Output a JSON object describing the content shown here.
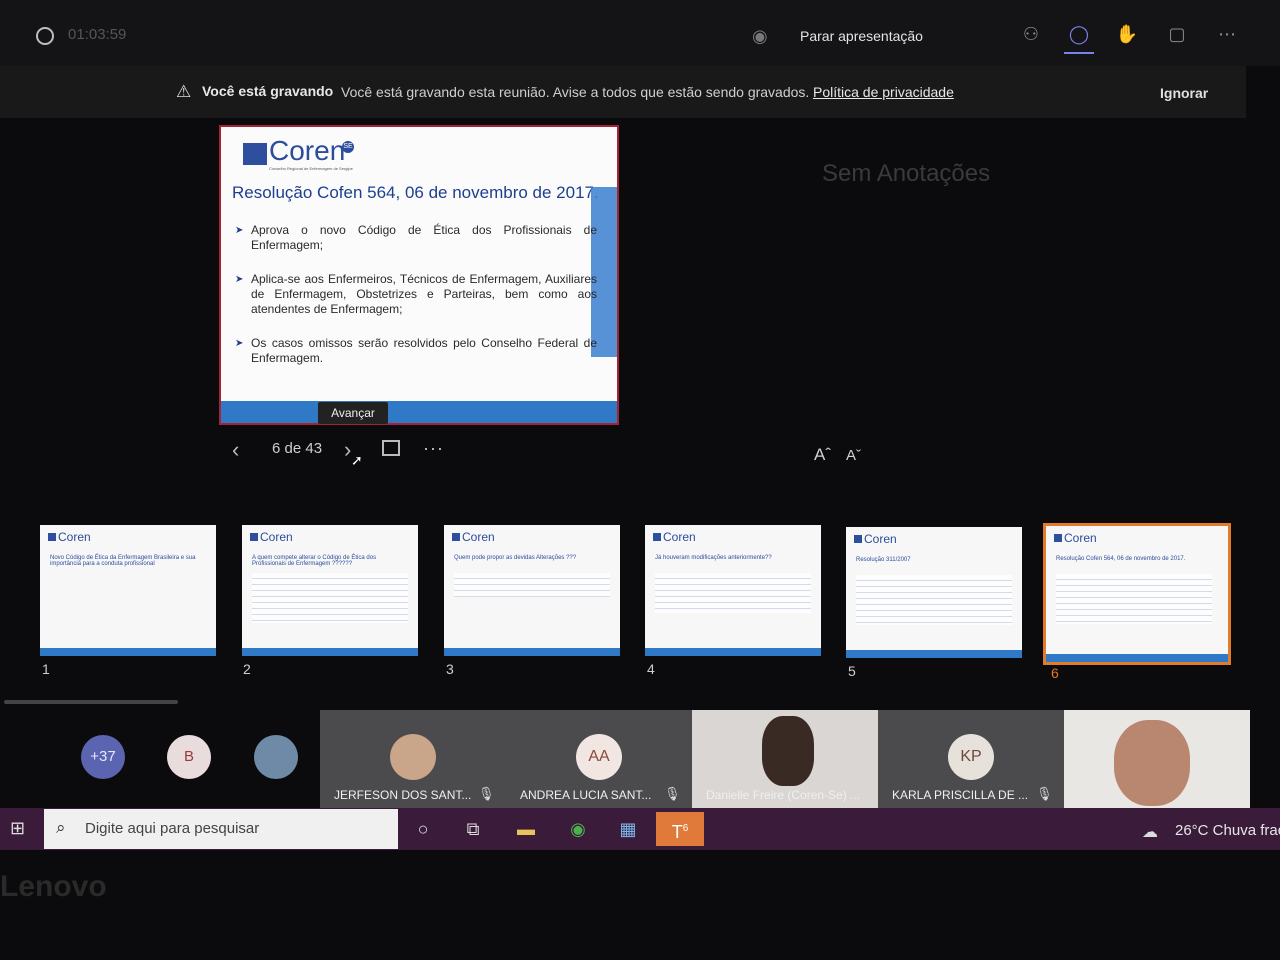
{
  "top_toolbar": {
    "timer": "01:03:59",
    "stop_presenting": "Parar apresentação"
  },
  "banner": {
    "bold": "Você está gravando",
    "text": "Você está gravando esta reunião. Avise a todos que estão sendo gravados.",
    "link": "Política de privacidade",
    "ignore": "Ignorar"
  },
  "slide": {
    "logo": "Coren",
    "logo_badge": "SE",
    "logo_subtitle": "Conselho Regional de Enfermagem de Sergipe",
    "title": "Resolução Cofen 564, 06 de novembro de 2017.",
    "bullets": [
      "Aprova o novo Código de Ética dos Profissionais de Enfermagem;",
      "Aplica-se aos Enfermeiros, Técnicos de Enfermagem, Auxiliares de Enfermagem, Obstetrizes e Parteiras, bem como aos atendentes de Enfermagem;",
      "Os casos omissos serão resolvidos pelo Conselho Federal de Enfermagem."
    ],
    "advance_tooltip": "Avançar"
  },
  "slide_nav": {
    "page_counter": "6 de 43",
    "prev_icon": "chevron-left-icon",
    "next_icon": "chevron-right-icon",
    "more": "···"
  },
  "notes": {
    "empty_text": "Sem Anotações",
    "font_increase": "Aˆ",
    "font_decrease": "Aˇ"
  },
  "thumbnails": [
    {
      "num": "1",
      "title": "Novo Código de Ética da Enfermagem Brasileira e sua importância para a conduta profissional"
    },
    {
      "num": "2",
      "title": "A quem compete alterar o Código de Ética dos Profissionais de Enfermagem ??????"
    },
    {
      "num": "3",
      "title": "Quem pode propor as devidas Alterações ???"
    },
    {
      "num": "4",
      "title": "Já houveram modificações anteriormente??"
    },
    {
      "num": "5",
      "title": "Resolução 311/2007"
    },
    {
      "num": "6",
      "title": "Resolução Cofen 564, 06 de novembro de 2017."
    }
  ],
  "participants": {
    "overflow": "+37",
    "b_initial": "B",
    "tiles": [
      {
        "name": "JERFESON DOS SANT...",
        "initials": ""
      },
      {
        "name": "ANDREA LUCIA SANT...",
        "initials": "AA"
      },
      {
        "name": "Danielle Freire (Coren-Se) ...",
        "initials": ""
      },
      {
        "name": "KARLA PRISCILLA DE ...",
        "initials": "KP"
      }
    ]
  },
  "taskbar": {
    "search_placeholder": "Digite aqui para pesquisar",
    "weather": "26°C  Chuva frac",
    "teams_badge": "6"
  },
  "device": {
    "brand": "Lenovo"
  },
  "colors": {
    "accent": "#7b83eb",
    "active_thumb": "#e17c2b",
    "slide_blue": "#2c4d9c",
    "slide_border": "#a52335",
    "taskbar": "#3a1c3a"
  }
}
